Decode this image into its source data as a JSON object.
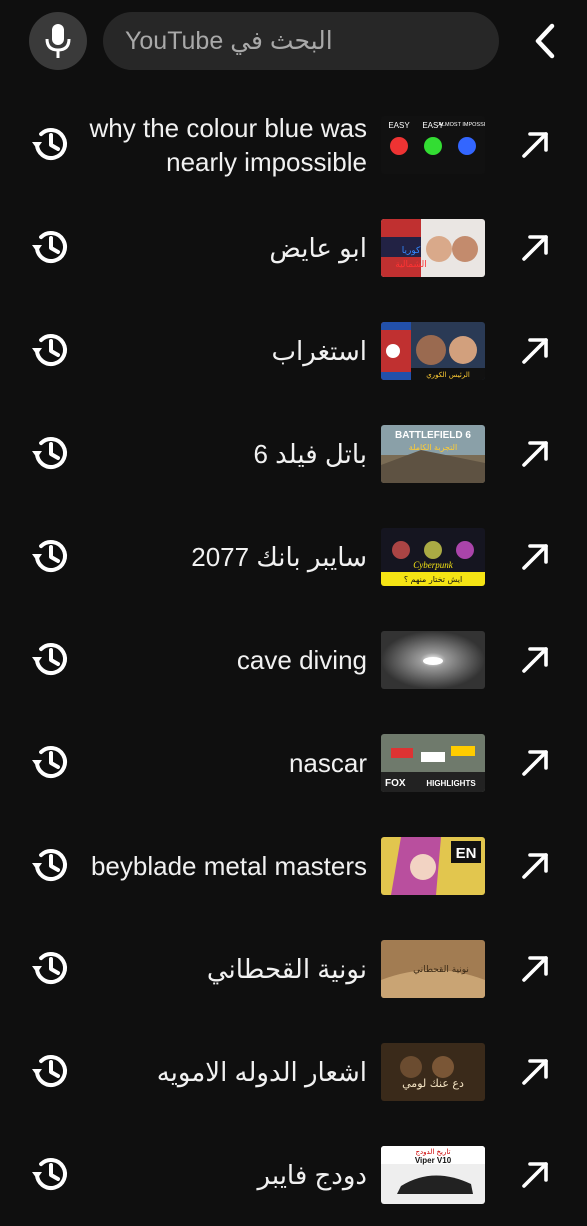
{
  "header": {
    "back_icon": "chevron-left-icon",
    "search_placeholder": "البحث في YouTube",
    "mic_icon": "microphone-icon"
  },
  "history": [
    {
      "title": "why the colour blue was nearly impossible",
      "thumb_text": [
        "EASY",
        "EASY",
        "ALMOST IMPOSSIBLE"
      ],
      "thumb_theme": "leds"
    },
    {
      "title": "ابو عايض",
      "thumb_text": [
        "كوريا",
        "الشمالية"
      ],
      "thumb_theme": "korea"
    },
    {
      "title": "استغراب",
      "thumb_text": [
        "الرئيس الكوري"
      ],
      "thumb_theme": "korea2"
    },
    {
      "title": "باتل فيلد 6",
      "thumb_text": [
        "BATTLEFIELD 6",
        "التجربة الكاملة"
      ],
      "thumb_theme": "battlefield"
    },
    {
      "title": "سايبر بانك 2077",
      "thumb_text": [
        "Cyberpunk",
        "ايش تختار منهم ؟"
      ],
      "thumb_theme": "cyberpunk"
    },
    {
      "title": "cave diving",
      "thumb_text": [],
      "thumb_theme": "cave"
    },
    {
      "title": "nascar",
      "thumb_text": [
        "FOX",
        "HIGHLIGHTS"
      ],
      "thumb_theme": "nascar"
    },
    {
      "title": "beyblade metal masters",
      "thumb_text": [
        "EN"
      ],
      "thumb_theme": "beyblade"
    },
    {
      "title": "نونية القحطاني",
      "thumb_text": [
        "نونية القحطاني"
      ],
      "thumb_theme": "book"
    },
    {
      "title": "اشعار الدوله الامويه",
      "thumb_text": [
        "دع عنك لومي"
      ],
      "thumb_theme": "poetry"
    },
    {
      "title": "دودج فايبر",
      "thumb_text": [
        "تاريخ الدودج",
        "Viper V10"
      ],
      "thumb_theme": "viper"
    }
  ],
  "icons": {
    "row_left": "history-icon",
    "row_right": "arrow-up-left-icon"
  }
}
